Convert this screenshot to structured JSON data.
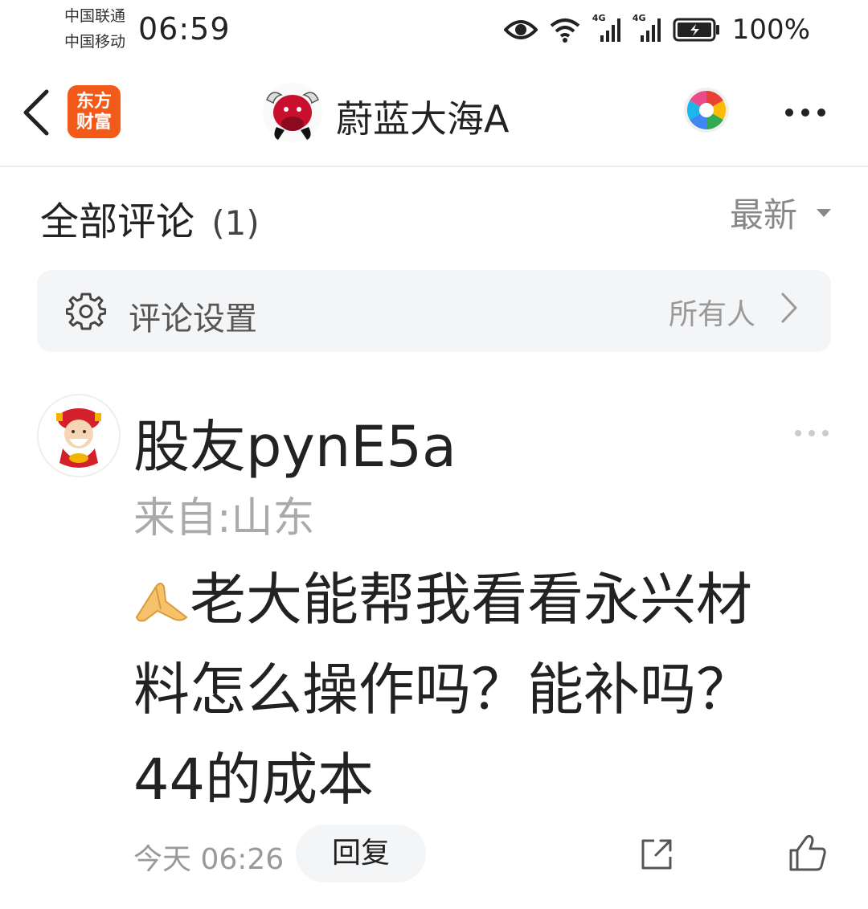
{
  "status_bar": {
    "carrier_1": "中国联通",
    "carrier_2": "中国移动",
    "time": "06:59",
    "network_1": "4G",
    "network_2": "4G",
    "battery": "100%"
  },
  "nav": {
    "app_logo_line1": "东方",
    "app_logo_line2": "财富",
    "title": "蔚蓝大海A",
    "icons": [
      "back-icon",
      "bull-avatar",
      "color-wheel-icon",
      "more-icon"
    ],
    "colors": {
      "logo": "#f25a1a",
      "bull": "#c8102e"
    }
  },
  "comments_header": {
    "title": "全部评论",
    "count": "(1)",
    "sort_label": "最新"
  },
  "settings": {
    "label": "评论设置",
    "value": "所有人"
  },
  "comment": {
    "username": "股友pynE5a",
    "location": "来自:山东",
    "body": "老大能帮我看看永兴材料怎么操作吗？能补吗？44的成本",
    "time": "今天 06:26",
    "reply_label": "回复"
  }
}
